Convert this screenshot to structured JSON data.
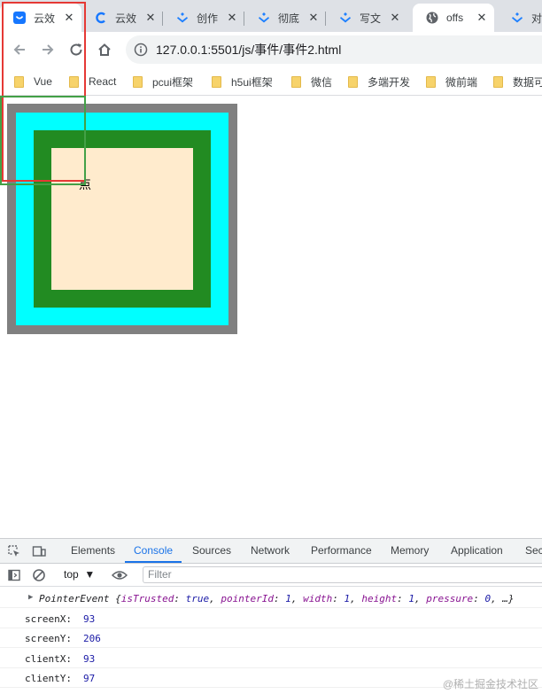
{
  "tabs": [
    {
      "title": "云效",
      "close": "✕",
      "favicon": "yunxiao-blue"
    },
    {
      "title": "云效",
      "close": "✕",
      "favicon": "yunxiao-c"
    },
    {
      "title": "创作",
      "close": "✕",
      "favicon": "juejin"
    },
    {
      "title": "彻底",
      "close": "✕",
      "favicon": "juejin"
    },
    {
      "title": "写文",
      "close": "✕",
      "favicon": "juejin"
    },
    {
      "title": "offs",
      "close": "✕",
      "favicon": "globe"
    },
    {
      "title": "对比",
      "close": "",
      "favicon": "juejin"
    }
  ],
  "toolbar": {
    "url": "127.0.0.1:5501/js/事件/事件2.html"
  },
  "bookmarks": [
    "Vue",
    "React",
    "pcui框架",
    "h5ui框架",
    "微信",
    "多端开发",
    "微前端",
    "数据可"
  ],
  "page": {
    "point_label": "点"
  },
  "devtools": {
    "tabs": [
      "Elements",
      "Console",
      "Sources",
      "Network",
      "Performance",
      "Memory",
      "Application",
      "Sec"
    ],
    "active_tab": "Console",
    "context": "top",
    "filter_placeholder": "Filter",
    "logs": {
      "event_type": "PointerEvent",
      "event_open": "{",
      "props": [
        {
          "k": "isTrusted",
          "v": "true"
        },
        {
          "k": "pointerId",
          "v": "1"
        },
        {
          "k": "width",
          "v": "1"
        },
        {
          "k": "height",
          "v": "1"
        },
        {
          "k": "pressure",
          "v": "0"
        }
      ],
      "event_tail": ", …}",
      "values": [
        {
          "label": "screenX:",
          "value": "93"
        },
        {
          "label": "screenY:",
          "value": "206"
        },
        {
          "label": "clientX:",
          "value": "93"
        },
        {
          "label": "clientY:",
          "value": "97"
        }
      ]
    }
  },
  "watermark": "@稀土掘金技术社区",
  "colors": {
    "outer": "#808080",
    "cyan": "#00ffff",
    "green": "#228b22",
    "inner": "#ffebcd",
    "annotation_red": "#e53935",
    "annotation_green": "#43a047",
    "accent": "#1a73e8"
  }
}
